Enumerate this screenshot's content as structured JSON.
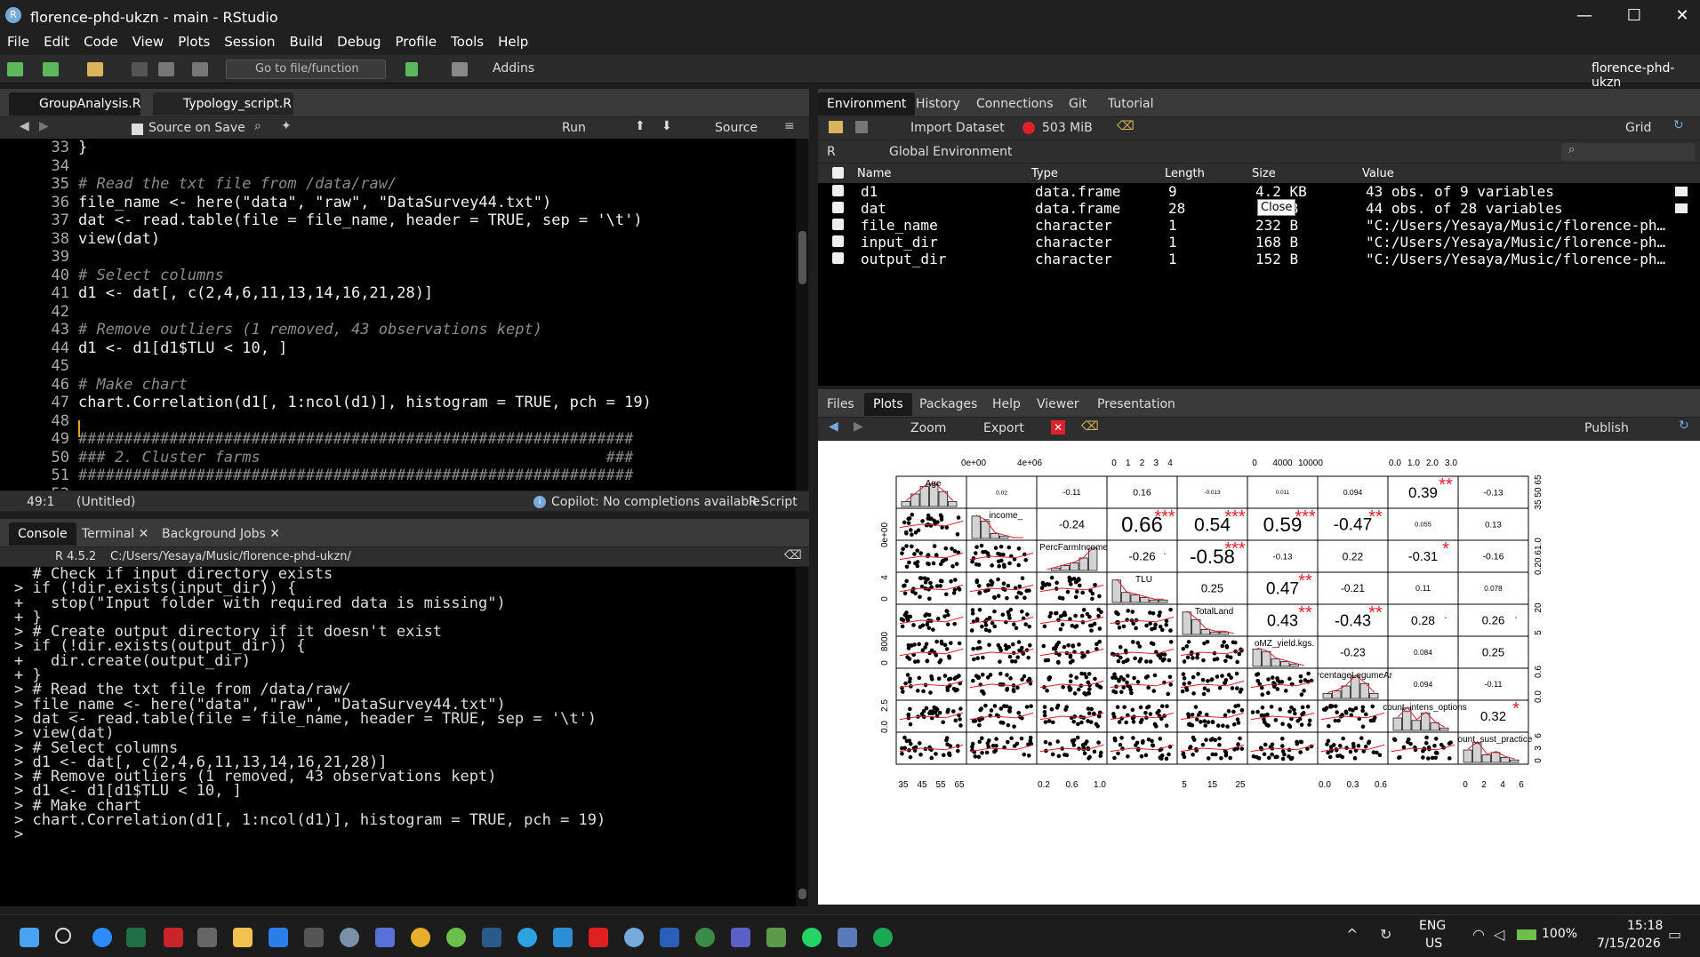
{
  "window": {
    "title": "florence-phd-ukzn - main - RStudio",
    "min": "—",
    "max": "☐",
    "close": "✕"
  },
  "menu": [
    "File",
    "Edit",
    "Code",
    "View",
    "Plots",
    "Session",
    "Build",
    "Debug",
    "Profile",
    "Tools",
    "Help"
  ],
  "toolbar": {
    "goto_placeholder": "Go to file/function",
    "addins": "Addins",
    "project": "florence-phd-ukzn"
  },
  "editor": {
    "tabs": [
      "GroupAnalysis.R",
      "Typology_script.R"
    ],
    "source_on_save": "Source on Save",
    "run": "Run",
    "source": "Source",
    "lines": [
      {
        "n": "33",
        "t": "}"
      },
      {
        "n": "34",
        "t": ""
      },
      {
        "n": "35",
        "t": "# Read the txt file from /data/raw/"
      },
      {
        "n": "36",
        "t": "file_name <- here(\"data\", \"raw\", \"DataSurvey44.txt\")"
      },
      {
        "n": "37",
        "t": "dat <- read.table(file = file_name, header = TRUE, sep = '\\t')"
      },
      {
        "n": "38",
        "t": "view(dat)"
      },
      {
        "n": "39",
        "t": ""
      },
      {
        "n": "40",
        "t": "# Select columns"
      },
      {
        "n": "41",
        "t": "d1 <- dat[, c(2,4,6,11,13,14,16,21,28)]"
      },
      {
        "n": "42",
        "t": ""
      },
      {
        "n": "43",
        "t": "# Remove outliers (1 removed, 43 observations kept)"
      },
      {
        "n": "44",
        "t": "d1 <- d1[d1$TLU < 10, ]"
      },
      {
        "n": "45",
        "t": ""
      },
      {
        "n": "46",
        "t": "# Make chart"
      },
      {
        "n": "47",
        "t": "chart.Correlation(d1[, 1:ncol(d1)], histogram = TRUE, pch = 19)"
      },
      {
        "n": "48",
        "t": ""
      },
      {
        "n": "49",
        "t": "#############################################################"
      },
      {
        "n": "50",
        "t": "### 2. Cluster farms                                      ###"
      },
      {
        "n": "51",
        "t": "#############################################################"
      },
      {
        "n": "52",
        "t": ""
      }
    ],
    "status_pos": "49:1",
    "status_scope": "(Untitled)",
    "copilot": "Copilot: No completions available.",
    "filetype": "R Script"
  },
  "console": {
    "tabs": [
      "Console",
      "Terminal",
      "Background Jobs"
    ],
    "version": "R 4.5.2",
    "path": "C:/Users/Yesaya/Music/florence-phd-ukzn/",
    "lines": [
      "  # Check if input directory exists",
      "> if (!dir.exists(input_dir)) {",
      "+   stop(\"Input folder with required data is missing\")",
      "+ }",
      "> # Create output directory if it doesn't exist",
      "> if (!dir.exists(output_dir)) {",
      "+   dir.create(output_dir)",
      "+ }",
      "> # Read the txt file from /data/raw/",
      "> file_name <- here(\"data\", \"raw\", \"DataSurvey44.txt\")",
      "> dat <- read.table(file = file_name, header = TRUE, sep = '\\t')",
      "> view(dat)",
      "> # Select columns",
      "> d1 <- dat[, c(2,4,6,11,13,14,16,21,28)]",
      "> # Remove outliers (1 removed, 43 observations kept)",
      "> d1 <- d1[d1$TLU < 10, ]",
      "> # Make chart",
      "> chart.Correlation(d1[, 1:ncol(d1)], histogram = TRUE, pch = 19)",
      "> "
    ]
  },
  "env": {
    "tabs": [
      "Environment",
      "History",
      "Connections",
      "Git",
      "Tutorial"
    ],
    "import": "Import Dataset",
    "mem": "503 MiB",
    "grid": "Grid",
    "lang": "R",
    "scope": "Global Environment",
    "headers": [
      "Name",
      "Type",
      "Length",
      "Size",
      "Value"
    ],
    "tooltip": "Close",
    "rows": [
      [
        "d1",
        "data.frame",
        "9",
        "4.2 KB",
        "43 obs. of 9 variables"
      ],
      [
        "dat",
        "data.frame",
        "28",
        "17 KB",
        "44 obs. of 28 variables"
      ],
      [
        "file_name",
        "character",
        "1",
        "232 B",
        "\"C:/Users/Yesaya/Music/florence-ph…"
      ],
      [
        "input_dir",
        "character",
        "1",
        "168 B",
        "\"C:/Users/Yesaya/Music/florence-ph…"
      ],
      [
        "output_dir",
        "character",
        "1",
        "152 B",
        "\"C:/Users/Yesaya/Music/florence-ph…"
      ]
    ]
  },
  "plots": {
    "tabs": [
      "Files",
      "Plots",
      "Packages",
      "Help",
      "Viewer",
      "Presentation"
    ],
    "zoom": "Zoom",
    "export": "Export",
    "publish": "Publish"
  },
  "chart_data": {
    "type": "scatter",
    "variables": [
      "Age",
      "_income_",
      "PercFarmIncome",
      "TLU",
      "TotalLand",
      "oMZ_yield.kgs.",
      "rcentageLegumeAr",
      "count_intens_options",
      "ount_sust_practice"
    ],
    "correlations": [
      {
        "cell": "1,2",
        "r": "0.02",
        "stars": ""
      },
      {
        "cell": "1,3",
        "r": "-0.11",
        "stars": ""
      },
      {
        "cell": "1,4",
        "r": "0.16",
        "stars": ""
      },
      {
        "cell": "1,5",
        "r": "-0.013",
        "stars": ""
      },
      {
        "cell": "1,6",
        "r": "0.011",
        "stars": ""
      },
      {
        "cell": "1,7",
        "r": "0.094",
        "stars": ""
      },
      {
        "cell": "1,8",
        "r": "0.39",
        "stars": "**"
      },
      {
        "cell": "1,9",
        "r": "-0.13",
        "stars": ""
      },
      {
        "cell": "2,3",
        "r": "-0.24",
        "stars": ""
      },
      {
        "cell": "2,4",
        "r": "0.66",
        "stars": "***"
      },
      {
        "cell": "2,5",
        "r": "0.54",
        "stars": "***"
      },
      {
        "cell": "2,6",
        "r": "0.59",
        "stars": "***"
      },
      {
        "cell": "2,7",
        "r": "-0.47",
        "stars": "**"
      },
      {
        "cell": "2,8",
        "r": "0.055",
        "stars": ""
      },
      {
        "cell": "2,9",
        "r": "0.13",
        "stars": ""
      },
      {
        "cell": "3,4",
        "r": "-0.26",
        "stars": "."
      },
      {
        "cell": "3,5",
        "r": "-0.58",
        "stars": "***"
      },
      {
        "cell": "3,6",
        "r": "-0.13",
        "stars": ""
      },
      {
        "cell": "3,7",
        "r": "0.22",
        "stars": ""
      },
      {
        "cell": "3,8",
        "r": "-0.31",
        "stars": "*"
      },
      {
        "cell": "3,9",
        "r": "-0.16",
        "stars": ""
      },
      {
        "cell": "4,5",
        "r": "0.25",
        "stars": ""
      },
      {
        "cell": "4,6",
        "r": "0.47",
        "stars": "**"
      },
      {
        "cell": "4,7",
        "r": "-0.21",
        "stars": ""
      },
      {
        "cell": "4,8",
        "r": "0.11",
        "stars": ""
      },
      {
        "cell": "4,9",
        "r": "0.078",
        "stars": ""
      },
      {
        "cell": "5,6",
        "r": "0.43",
        "stars": "**"
      },
      {
        "cell": "5,7",
        "r": "-0.43",
        "stars": "**"
      },
      {
        "cell": "5,8",
        "r": "0.28",
        "stars": "."
      },
      {
        "cell": "5,9",
        "r": "0.26",
        "stars": "."
      },
      {
        "cell": "6,7",
        "r": "-0.23",
        "stars": ""
      },
      {
        "cell": "6,8",
        "r": "0.084",
        "stars": ""
      },
      {
        "cell": "6,9",
        "r": "0.25",
        "stars": ""
      },
      {
        "cell": "7,8",
        "r": "0.094",
        "stars": ""
      },
      {
        "cell": "7,9",
        "r": "-0.11",
        "stars": ""
      },
      {
        "cell": "8,9",
        "r": "0.32",
        "stars": "*"
      }
    ],
    "top_ticks": [
      [
        "0e+00",
        "4e+06"
      ],
      [
        "0",
        "1",
        "2",
        "3",
        "4"
      ],
      [
        "0",
        "4000",
        "10000"
      ],
      [
        "0.0",
        "1.0",
        "2.0",
        "3.0"
      ]
    ],
    "bottom_ticks": [
      [
        "35",
        "45",
        "55",
        "65"
      ],
      [
        "0.2",
        "0.6",
        "1.0"
      ],
      [
        "5",
        "15",
        "25"
      ],
      [
        "0.0",
        "0.3",
        "0.6"
      ],
      [
        "0",
        "2",
        "4",
        "6"
      ]
    ],
    "left_ticks": [
      [
        "0e+00"
      ],
      [
        "0",
        "4"
      ],
      [
        "0",
        "8000"
      ],
      [
        "0.0",
        "2.5"
      ]
    ],
    "right_ticks": [
      [
        "35",
        "50",
        "65"
      ],
      [
        "0.2",
        "0.6",
        "1.0"
      ],
      [
        "5",
        "20"
      ],
      [
        "0.0",
        "0.6"
      ],
      [
        "0",
        "3",
        "6"
      ]
    ]
  },
  "taskbar": {
    "lang": "ENG",
    "region": "US",
    "battery": "100%",
    "time": "15:18",
    "date": "7/15/2026"
  },
  "colors": {
    "accent": "#75aadb",
    "red": "#e0202a",
    "panel": "#000000"
  }
}
